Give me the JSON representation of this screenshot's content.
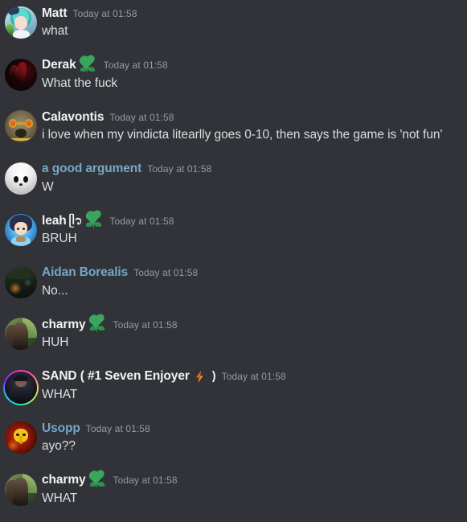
{
  "app": {
    "name": "Discord",
    "theme_background": "#313338",
    "text_color": "#dbdee1",
    "username_plain_color": "#f2f3f5",
    "username_colored_color": "#74a8c6",
    "timestamp_color": "#949ba4",
    "accent_green": "#3ba55d",
    "accent_orange": "#e8601f"
  },
  "messages": [
    {
      "username": "Matt",
      "name_decoration": "",
      "name_color": "plain",
      "badge": "",
      "timestamp": "Today at 01:58",
      "text": "what",
      "avatar": "miku",
      "avatar_ring": false
    },
    {
      "username": "Derak",
      "name_decoration": "",
      "name_color": "plain",
      "badge": "green-heart-leaves",
      "timestamp": "Today at 01:58",
      "text": "What the fuck",
      "avatar": "dark-red",
      "avatar_ring": false
    },
    {
      "username": "Calavontis",
      "name_decoration": "",
      "name_color": "plain",
      "badge": "",
      "timestamp": "Today at 01:58",
      "text": "i love when my vindicta litearlly goes 0-10, then says the game is 'not fun'",
      "avatar": "pug",
      "avatar_ring": false
    },
    {
      "username": "a good argument",
      "name_decoration": "",
      "name_color": "colored",
      "badge": "",
      "timestamp": "Today at 01:58",
      "text": "W",
      "avatar": "white-hamster",
      "avatar_ring": false
    },
    {
      "username": "leah",
      "name_decoration": "ᥫ᭡",
      "name_color": "plain",
      "badge": "green-heart-leaves",
      "timestamp": "Today at 01:58",
      "text": "BRUH",
      "avatar": "anime-girl",
      "avatar_ring": false
    },
    {
      "username": "Aidan Borealis",
      "name_decoration": "",
      "name_color": "colored",
      "badge": "",
      "timestamp": "Today at 01:58",
      "text": "No...",
      "avatar": "outdoor",
      "avatar_ring": false
    },
    {
      "username": "charmy",
      "name_decoration": "",
      "name_color": "plain",
      "badge": "green-heart-leaves",
      "timestamp": "Today at 01:58",
      "text": "HUH",
      "avatar": "charmy",
      "avatar_ring": false
    },
    {
      "username": "SAND ( #1 Seven Enjoyer",
      "name_decoration": ")",
      "name_color": "plain",
      "badge": "lightning-bolt",
      "timestamp": "Today at 01:58",
      "text": "WHAT",
      "avatar": "sand",
      "avatar_ring": true
    },
    {
      "username": "Usopp",
      "name_decoration": "",
      "name_color": "colored",
      "badge": "",
      "timestamp": "Today at 01:58",
      "text": "ayo??",
      "avatar": "usopp",
      "avatar_ring": false
    },
    {
      "username": "charmy",
      "name_decoration": "",
      "name_color": "plain",
      "badge": "green-heart-leaves",
      "timestamp": "Today at 01:58",
      "text": "WHAT",
      "avatar": "charmy",
      "avatar_ring": false
    }
  ]
}
